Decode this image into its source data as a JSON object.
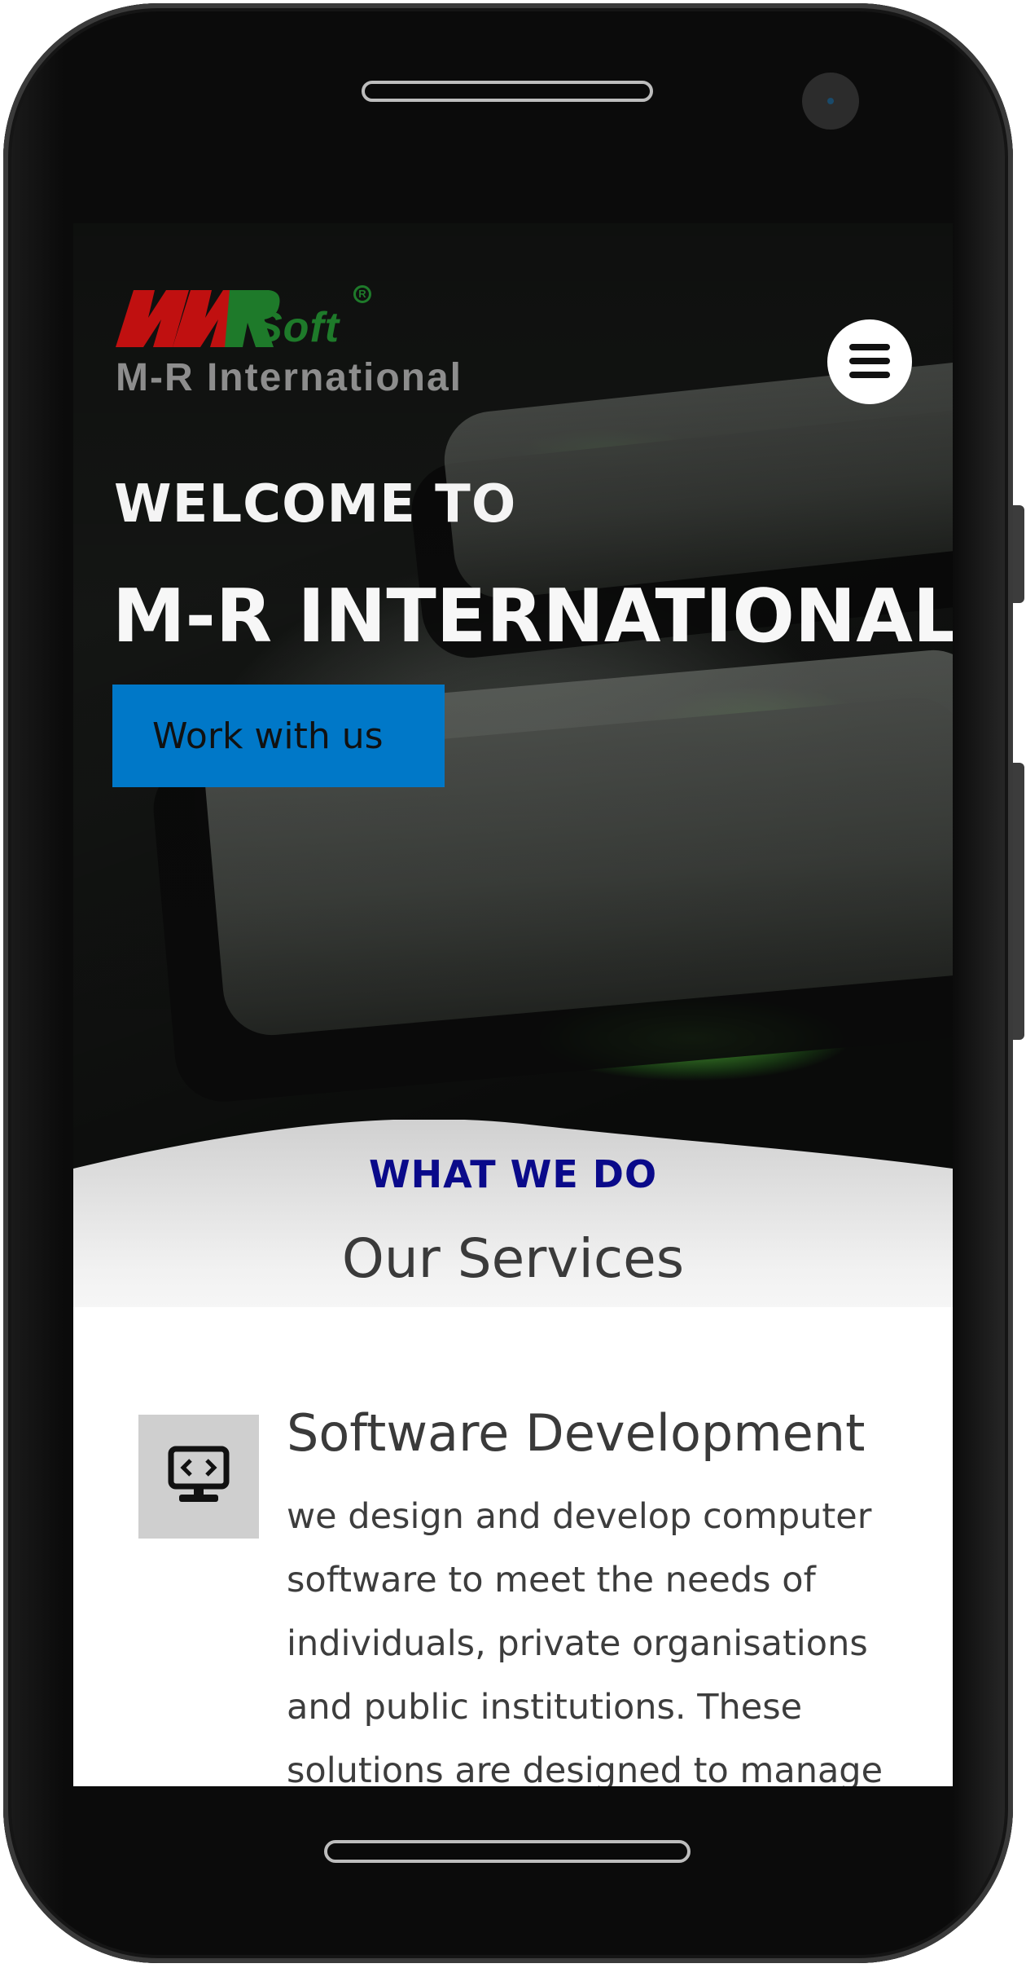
{
  "logo": {
    "mark_text": "Soft",
    "registered_symbol": "R",
    "company_name": "M-R International"
  },
  "header": {
    "menu_icon": "hamburger-menu-icon"
  },
  "hero": {
    "welcome": "WELCOME TO",
    "title": "M-R INTERNATIONAL",
    "cta_label": "Work with us",
    "cta_color": "#0078c8"
  },
  "services": {
    "eyebrow": "WHAT WE DO",
    "title": "Our Services",
    "eyebrow_color": "#0a0a8a",
    "items": [
      {
        "icon": "computer-code-icon",
        "title": "Software Development",
        "description": "we design and develop computer software to meet the needs of individuals, private organisations and public institutions. These solutions are designed to manage their several"
      }
    ]
  }
}
